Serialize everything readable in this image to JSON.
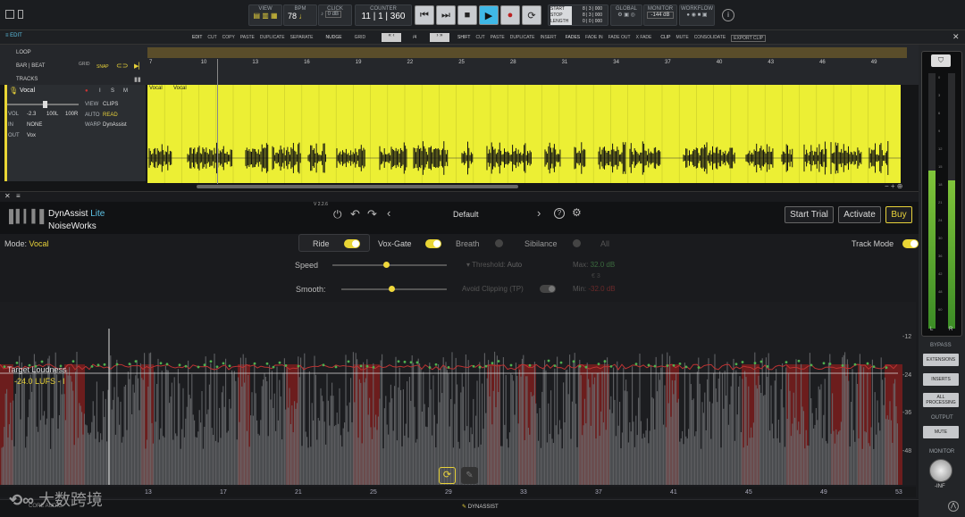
{
  "transport": {
    "view_label": "VIEW",
    "bpm_label": "BPM",
    "bpm": "78",
    "click_label": "CLICK",
    "click_db": "0 dB",
    "counter_label": "COUNTER",
    "counter": "11 | 1 | 360",
    "start_label": "START",
    "stop_label": "STOP",
    "length_label": "LENGTH",
    "start_val": "8 | 3 | 000",
    "stop_val": "8 | 3 | 000",
    "length_val": "0 | 0 | 000",
    "global_label": "GLOBAL",
    "monitor_label": "MONITOR",
    "monitor_db": "-144 dB",
    "workflow_label": "WORKFLOW"
  },
  "edit_bar": {
    "edit": "EDIT",
    "items": [
      "EDIT",
      "CUT",
      "COPY",
      "PASTE",
      "DUPLICATE",
      "SEPARATE"
    ],
    "nudge": "NUDGE",
    "grid": "GRID",
    "grid_val": "/4",
    "shift": "SHIFT",
    "shift_items": [
      "CUT",
      "PASTE",
      "DUPLICATE",
      "INSERT"
    ],
    "fades": "FADES",
    "fade_items": [
      "FADE IN",
      "FADE OUT",
      "X FADE"
    ],
    "clip": "CLIP",
    "clip_items": [
      "MUTE",
      "CONSOLIDATE",
      "EXPORT CLIP"
    ]
  },
  "timeline": {
    "loop": "LOOP",
    "bar_beat": "BAR | BEAT",
    "grid_label": "GRID",
    "grid_val": "/4",
    "snap": "SNAP",
    "tracks": "TRACKS",
    "bars": [
      "7",
      "10",
      "13",
      "16",
      "19",
      "22",
      "25",
      "28",
      "31",
      "34",
      "37",
      "40",
      "43",
      "46",
      "49"
    ]
  },
  "track": {
    "name": "Vocal",
    "i": "I",
    "s": "S",
    "m": "M",
    "vol_label": "VOL",
    "vol": "-2.3",
    "l": "100L",
    "r": "100R",
    "in_label": "IN",
    "in_val": "NONE",
    "out_label": "OUT",
    "out_val": "Vox",
    "view_label": "VIEW",
    "view_val": "CLIPS",
    "auto_label": "AUTO",
    "auto_val": "READ",
    "warp_label": "WARP",
    "warp_val": "DynAssist",
    "clip_name": "Vocal",
    "clip_name2": "Vocal"
  },
  "plugin": {
    "brand": "DynAssist",
    "brand_suffix": "Lite",
    "vendor": "NoiseWorks",
    "version": "V 2.2.6",
    "preset": "Default",
    "start_trial": "Start Trial",
    "activate": "Activate",
    "buy": "Buy",
    "mode_label": "Mode:",
    "mode_val": "Vocal",
    "tabs": [
      "Ride",
      "Vox-Gate",
      "Breath",
      "Sibilance",
      "All"
    ],
    "track_mode": "Track Mode",
    "speed": "Speed",
    "smooth": "Smooth:",
    "threshold_label": "Threshold:",
    "threshold_val": "Auto",
    "avoid_clipping": "Avoid Clipping (TP)",
    "max_label": "Max:",
    "max_val": "32.0 dB",
    "max_sub": "€ 3",
    "min_label": "Min:",
    "min_val": "-32.0 dB",
    "target_label": "Target Loudness",
    "target_val": "-24.0 LUFS - I",
    "scale": [
      "-12",
      "-24",
      "-36",
      "-48"
    ],
    "ruler": [
      "13",
      "17",
      "21",
      "25",
      "29",
      "33",
      "37",
      "41",
      "45",
      "49",
      "53"
    ],
    "footer": "DYNASSIST",
    "core": "CORE AUDIO"
  },
  "right_panel": {
    "bypass": "BYPASS",
    "extensions": "EXTENSIONS",
    "inserts": "INSERTS",
    "all_processing": "ALL PROCESSING",
    "output": "OUTPUT",
    "mute": "MUTE",
    "monitor": "MONITOR",
    "inf": "-INF",
    "l": "L",
    "r": "R",
    "meter_scale": [
      "0",
      "3",
      "6",
      "9",
      "12",
      "15",
      "18",
      "21",
      "24",
      "30",
      "36",
      "42",
      "48",
      "60"
    ]
  },
  "watermark": "大数跨境",
  "colors": {
    "clip": "#ecef34",
    "accent": "#f0d83c",
    "red": "#8a2020"
  }
}
